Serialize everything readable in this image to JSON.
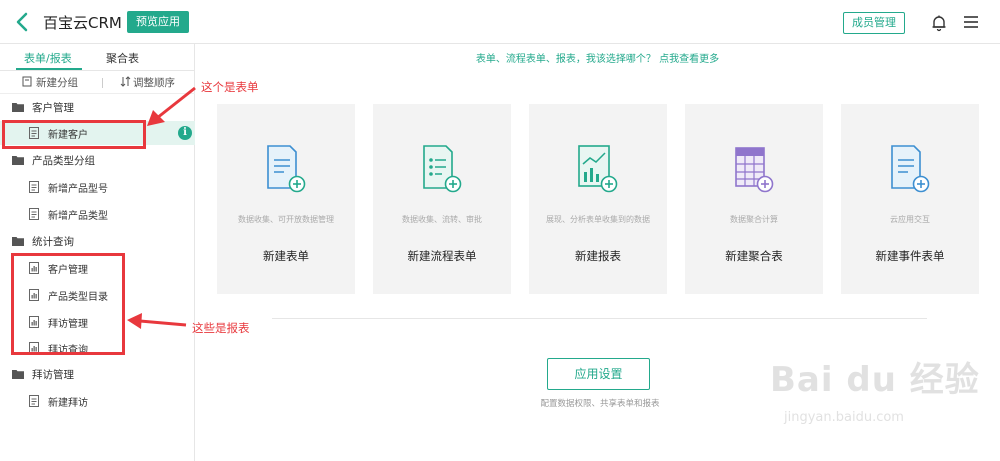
{
  "header": {
    "app_title": "百宝云CRM",
    "preview_button": "预览应用",
    "member_button": "成员管理"
  },
  "sidebar": {
    "tabs": [
      "表单/报表",
      "聚合表"
    ],
    "actions": {
      "new_group": "新建分组",
      "reorder": "调整顺序"
    },
    "groups": [
      {
        "label": "客户管理",
        "items": [
          {
            "label": "新建客户",
            "type": "form",
            "selected": true
          }
        ]
      },
      {
        "label": "产品类型分组",
        "items": [
          {
            "label": "新增产品型号",
            "type": "form"
          },
          {
            "label": "新增产品类型",
            "type": "form"
          }
        ]
      },
      {
        "label": "统计查询",
        "items": [
          {
            "label": "客户管理",
            "type": "report"
          },
          {
            "label": "产品类型目录",
            "type": "report"
          },
          {
            "label": "拜访管理",
            "type": "report"
          },
          {
            "label": "拜访查询",
            "type": "report"
          }
        ]
      },
      {
        "label": "拜访管理",
        "items": [
          {
            "label": "新建拜访",
            "type": "form"
          }
        ]
      }
    ]
  },
  "annotations": {
    "form_note": "这个是表单",
    "report_note": "这些是报表"
  },
  "main": {
    "hint": "表单、流程表单、报表，我该选择哪个？ 点我查看更多",
    "cards": [
      {
        "desc": "数据收集、可开放数据管理",
        "title": "新建表单",
        "icon": "form-icon"
      },
      {
        "desc": "数据收集、流转、审批",
        "title": "新建流程表单",
        "icon": "flow-form-icon"
      },
      {
        "desc": "展现、分析表单收集到的数据",
        "title": "新建报表",
        "icon": "report-icon"
      },
      {
        "desc": "数据聚合计算",
        "title": "新建聚合表",
        "icon": "aggregate-table-icon"
      },
      {
        "desc": "云应用交互",
        "title": "新建事件表单",
        "icon": "event-form-icon"
      }
    ],
    "settings_button": "应用设置",
    "settings_sub": "配置数据权限、共享表单和报表"
  },
  "watermark": {
    "main": "Bai du 经验",
    "sub": "jingyan.baidu.com"
  },
  "colors": {
    "accent": "#23a98c",
    "annotation": "#e8383d"
  }
}
